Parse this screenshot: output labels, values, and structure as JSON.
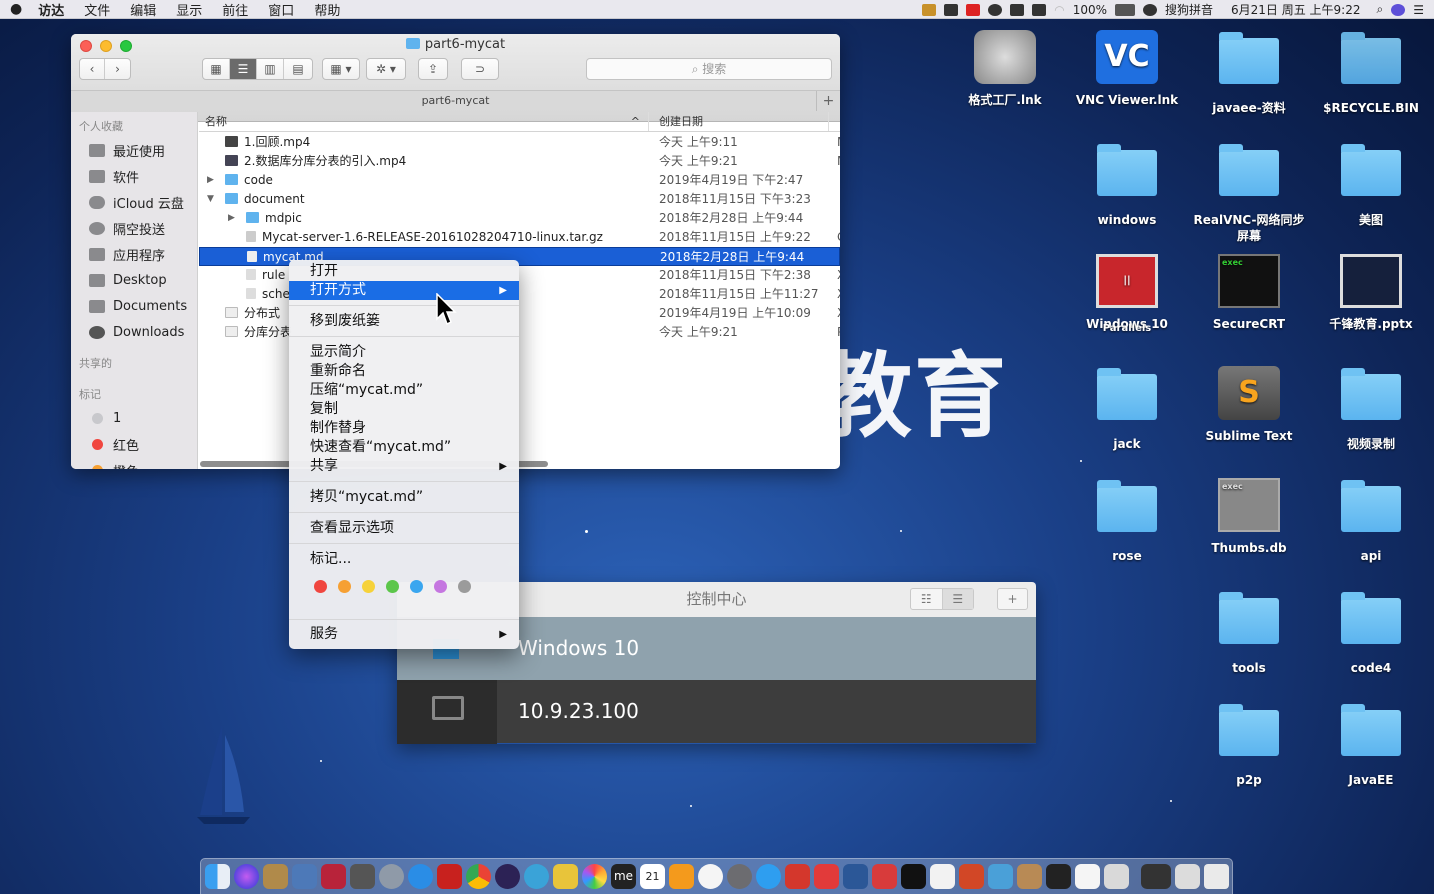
{
  "menubar": {
    "apple": "",
    "app": "访达",
    "items": [
      "文件",
      "编辑",
      "显示",
      "前往",
      "窗口",
      "帮助"
    ],
    "battery": "100%",
    "ime": "搜狗拼音",
    "datetime": "6月21日 周五 上午9:22"
  },
  "finder": {
    "title": "part6-mycat",
    "path": "part6-mycat",
    "search_placeholder": "搜索",
    "sidebar": {
      "favorites_header": "个人收藏",
      "favorites": [
        "最近使用",
        "软件",
        "iCloud 云盘",
        "隔空投送",
        "应用程序",
        "Desktop",
        "Documents",
        "Downloads"
      ],
      "shared_header": "共享的",
      "tags_header": "标记",
      "tags": [
        {
          "label": "1",
          "color": "#c8c8cc"
        },
        {
          "label": "红色",
          "color": "#f0463f"
        },
        {
          "label": "橙色",
          "color": "#f6a033"
        }
      ]
    },
    "columns": {
      "name": "名称",
      "date": "创建日期"
    },
    "rows": [
      {
        "name": "1.回顾.mp4",
        "date": "今天 上午9:11",
        "extra": "M"
      },
      {
        "name": "2.数据库分库分表的引入.mp4",
        "date": "今天 上午9:21",
        "extra": "M"
      },
      {
        "name": "code",
        "date": "2019年4月19日 下午2:47",
        "extra": ""
      },
      {
        "name": "document",
        "date": "2018年11月15日 下午3:23",
        "extra": ""
      },
      {
        "name": "mdpic",
        "date": "2018年2月28日 上午9:44",
        "extra": ""
      },
      {
        "name": "Mycat-server-1.6-RELEASE-20161028204710-linux.tar.gz",
        "date": "2018年11月15日 上午9:22",
        "extra": "G"
      },
      {
        "name": "mycat.md",
        "date": "2018年2月28日 上午9:44",
        "extra": ""
      },
      {
        "name": "rule",
        "date": "2018年11月15日 下午2:38",
        "extra": "X"
      },
      {
        "name": "sche",
        "date": "2018年11月15日 上午11:27",
        "extra": "X"
      },
      {
        "name": "分布式",
        "date": "2019年4月19日 上午10:09",
        "extra": "X"
      },
      {
        "name": "分库分表",
        "date": "今天 上午9:21",
        "extra": "P"
      }
    ]
  },
  "context_menu": {
    "open": "打开",
    "open_with": "打开方式",
    "trash": "移到废纸篓",
    "get_info": "显示简介",
    "rename": "重新命名",
    "compress": "压缩“mycat.md”",
    "duplicate": "复制",
    "alias": "制作替身",
    "quicklook": "快速查看“mycat.md”",
    "share": "共享",
    "copy": "拷贝“mycat.md”",
    "view_options": "查看显示选项",
    "tags": "标记...",
    "services": "服务",
    "tag_colors": [
      "#f0463f",
      "#f6a033",
      "#f6d23a",
      "#5cc64a",
      "#3aa6ef",
      "#c576e0",
      "#9b9b9b"
    ]
  },
  "control_center": {
    "title": "控制中心",
    "hosts": [
      "Windows 10",
      "10.9.23.100"
    ]
  },
  "watermark": "教育",
  "desktop": [
    {
      "label": "格式工厂.lnk",
      "kind": "app"
    },
    {
      "label": "VNC Viewer.lnk",
      "kind": "app"
    },
    {
      "label": "javaee-资料",
      "kind": "folder"
    },
    {
      "label": "$RECYCLE.BIN",
      "kind": "folder"
    },
    {
      "label": "windows",
      "kind": "folder"
    },
    {
      "label": "RealVNC-网络同步屏幕",
      "kind": "folder"
    },
    {
      "label": "美图",
      "kind": "folder"
    },
    {
      "label": "Windows 10",
      "kind": "app"
    },
    {
      "label": "SecureCRT",
      "kind": "app"
    },
    {
      "label": "千锋教育.pptx",
      "kind": "file"
    },
    {
      "label": "jack",
      "kind": "folder"
    },
    {
      "label": "Sublime Text",
      "kind": "app"
    },
    {
      "label": "视频录制",
      "kind": "folder"
    },
    {
      "label": "rose",
      "kind": "folder"
    },
    {
      "label": "Thumbs.db",
      "kind": "file"
    },
    {
      "label": "api",
      "kind": "folder"
    },
    {
      "label": "tools",
      "kind": "folder"
    },
    {
      "label": "code4",
      "kind": "folder"
    },
    {
      "label": "p2p",
      "kind": "folder"
    },
    {
      "label": "JavaEE",
      "kind": "folder"
    }
  ],
  "icon_text": {
    "vnc": "VC",
    "parallels": "|| Parallels",
    "exec": "exec",
    "sublime": "S",
    "dock_me": "me",
    "dock_cal": "21"
  }
}
